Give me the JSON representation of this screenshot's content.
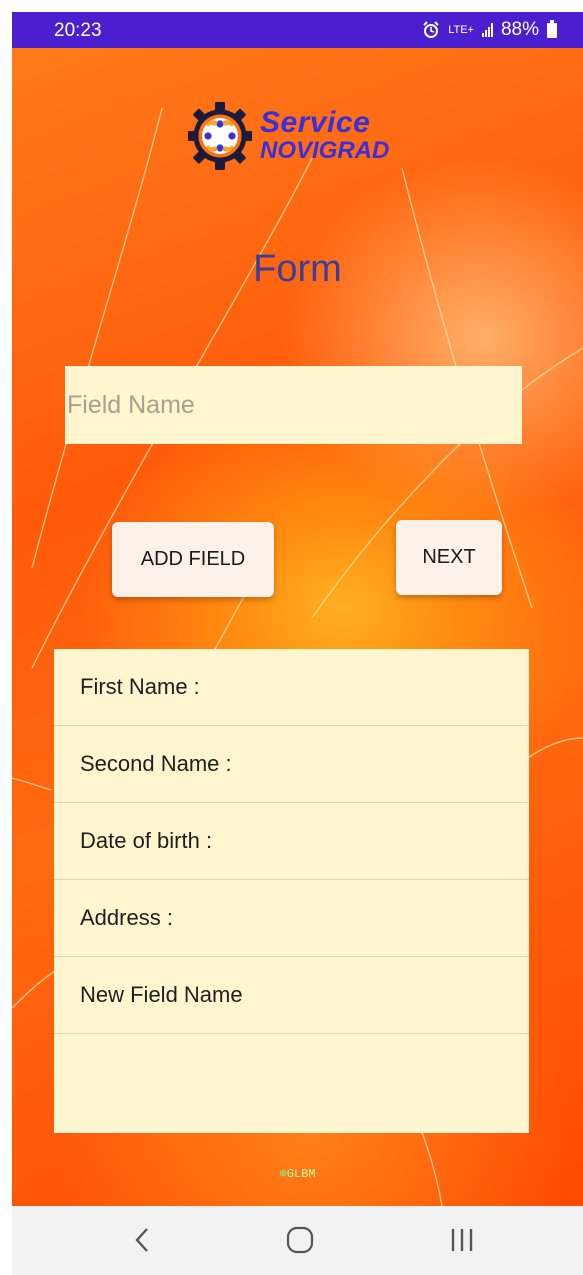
{
  "status_bar": {
    "time": "20:23",
    "network": "LTE+",
    "battery": "88%"
  },
  "logo": {
    "line1": "Service",
    "line2": "NOVIGRAD"
  },
  "form": {
    "title": "Form",
    "field_placeholder": "Field Name",
    "add_button": "ADD FIELD",
    "next_button": "NEXT"
  },
  "fields": [
    "First Name :",
    "Second Name :",
    "Date of birth :",
    "Address :",
    "New Field Name"
  ],
  "watermark": "GLBM",
  "nav": {
    "back_icon": "chevron-left-icon",
    "home_icon": "home-circle-icon",
    "recents_icon": "recents-icon"
  },
  "colors": {
    "status_bar": "#4b1fd0",
    "accent": "#3a2fd8",
    "input_bg": "#fff6cf",
    "button_bg": "#fcf1e8"
  }
}
